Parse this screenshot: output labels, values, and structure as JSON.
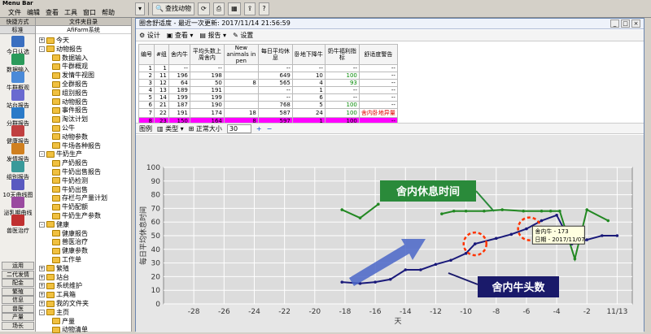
{
  "menubar": {
    "title": "Menu Bar",
    "items": [
      "文件",
      "编辑",
      "查看",
      "工具",
      "窗口",
      "帮助"
    ]
  },
  "toolbar": {
    "search_label": "查找动物"
  },
  "nav": {
    "header": "快捷方式",
    "top": "标准",
    "items": [
      "今日认选",
      "数据输入",
      "牛群概观",
      "站台报告",
      "分群报告",
      "健康报告",
      "发情报告",
      "组别报告",
      "10天曲线图",
      "泌乳期曲线",
      "兽医治疗"
    ],
    "bottom": [
      "运用",
      "二代发情",
      "配金",
      "繁殖",
      "信息",
      "兽医",
      "产量",
      "场长"
    ]
  },
  "tree": {
    "header": "文件夹目录",
    "sub": "AfiFarm系统",
    "nodes": [
      {
        "t": "今天",
        "l": 0,
        "pm": "+"
      },
      {
        "t": "动物报告",
        "l": 0,
        "pm": "-"
      },
      {
        "t": "数据输入",
        "l": 1
      },
      {
        "t": "牛群概观",
        "l": 1
      },
      {
        "t": "发情牛视图",
        "l": 1
      },
      {
        "t": "全群报告",
        "l": 1
      },
      {
        "t": "组别报告",
        "l": 1
      },
      {
        "t": "动物报告",
        "l": 1
      },
      {
        "t": "事件报告",
        "l": 1
      },
      {
        "t": "淘汰计划",
        "l": 1
      },
      {
        "t": "公牛",
        "l": 1
      },
      {
        "t": "动物参数",
        "l": 1
      },
      {
        "t": "牛场各种报告",
        "l": 1
      },
      {
        "t": "牛奶生产",
        "l": 0,
        "pm": "-"
      },
      {
        "t": "产奶报告",
        "l": 1
      },
      {
        "t": "牛奶出售报告",
        "l": 1
      },
      {
        "t": "牛奶检测",
        "l": 1
      },
      {
        "t": "牛奶出售",
        "l": 1
      },
      {
        "t": "存栏与产量计划",
        "l": 1
      },
      {
        "t": "牛奶配额",
        "l": 1
      },
      {
        "t": "牛奶生产参数",
        "l": 1
      },
      {
        "t": "健康",
        "l": 0,
        "pm": "-"
      },
      {
        "t": "健康报告",
        "l": 1
      },
      {
        "t": "兽医治疗",
        "l": 1
      },
      {
        "t": "健康参数",
        "l": 1
      },
      {
        "t": "工作单",
        "l": 1
      },
      {
        "t": "繁殖",
        "l": 0,
        "pm": "+"
      },
      {
        "t": "站台",
        "l": 0,
        "pm": "+"
      },
      {
        "t": "系统维护",
        "l": 0,
        "pm": "+"
      },
      {
        "t": "工具箱",
        "l": 0,
        "pm": "+"
      },
      {
        "t": "我的文件夹",
        "l": 0,
        "pm": "+"
      },
      {
        "t": "主页",
        "l": 0,
        "pm": "-"
      },
      {
        "t": "产量",
        "l": 1
      },
      {
        "t": "动物清单",
        "l": 1
      }
    ]
  },
  "window": {
    "title": "圈舍舒适度 - 最近一次更新: 2017/11/14 21:56:59",
    "tools": [
      "设计",
      "查看",
      "报告",
      "设置"
    ]
  },
  "table": {
    "headers": [
      "编号",
      "#组",
      "舍内牛",
      "平均头数上周舍内",
      "New animals in pen",
      "每日平均休息",
      "卧地下降牛",
      "奶牛福利指标",
      "舒适度警告"
    ],
    "rows": [
      [
        "1",
        "1",
        "--",
        "--",
        "",
        "--",
        "--",
        "--",
        "--"
      ],
      [
        "2",
        "11",
        "196",
        "198",
        "",
        "649",
        "10",
        "100",
        "--"
      ],
      [
        "3",
        "12",
        "64",
        "50",
        "8",
        "565",
        "4",
        "93",
        "--"
      ],
      [
        "4",
        "13",
        "189",
        "191",
        "",
        "--",
        "1",
        "--",
        "--"
      ],
      [
        "5",
        "14",
        "199",
        "199",
        "",
        "--",
        "6",
        "--",
        "--"
      ],
      [
        "6",
        "21",
        "187",
        "190",
        "",
        "768",
        "5",
        "100",
        "--"
      ],
      [
        "7",
        "22",
        "191",
        "174",
        "18",
        "587",
        "24",
        "100",
        "舍内卧地异量"
      ],
      [
        "8",
        "23",
        "150",
        "164",
        "8",
        "597",
        "1",
        "100",
        "--"
      ]
    ]
  },
  "chart_toolbar": {
    "legend": "图例",
    "type": "类型",
    "size": "正常大小",
    "zoom": "30"
  },
  "chart_data": {
    "type": "line",
    "ylabel": "每日平均休息时间",
    "xlabel": "天",
    "ylim": [
      0,
      100
    ],
    "yticks": [
      "0",
      "10",
      "20",
      "30",
      "40",
      "50",
      "60",
      "70",
      "80",
      "90",
      "100"
    ],
    "xticks": [
      "-28",
      "-26",
      "-24",
      "-22",
      "-20",
      "-18",
      "-16",
      "-14",
      "-12",
      "-10",
      "-8",
      "-6",
      "-4",
      "-2",
      "11/13"
    ],
    "series": [
      {
        "name": "舍内休息时间",
        "color": "#228822",
        "x": [
          -18.2,
          -17,
          -15.8,
          null,
          -11.6,
          -10.8,
          -10,
          -8.8,
          -7.6,
          -6.2,
          -5,
          -4.4,
          -3.8,
          -2.8,
          -2,
          -0.6
        ],
        "y": [
          69,
          63,
          73,
          null,
          66,
          68,
          68,
          68,
          69,
          68,
          68,
          68,
          68,
          33,
          69,
          61
        ]
      },
      {
        "name": "舍内牛头数",
        "color": "#1a1a7a",
        "x": [
          -18.2,
          -17,
          -16,
          -15,
          -14,
          -13,
          -12,
          -11,
          -10,
          -9.4,
          -8,
          -7,
          -6,
          -5,
          -4,
          -3,
          -2,
          -1,
          0
        ],
        "y": [
          16,
          15,
          16,
          18,
          25,
          25,
          29,
          32,
          37,
          44,
          48,
          51,
          55,
          61,
          65,
          44,
          47,
          50,
          50
        ]
      }
    ],
    "tooltip": {
      "line1": "舍内牛 - 173",
      "line2": "日期 - 2017/11/07"
    },
    "annot_rest": "舍内休息时间",
    "annot_count": "舍内牛头数"
  }
}
